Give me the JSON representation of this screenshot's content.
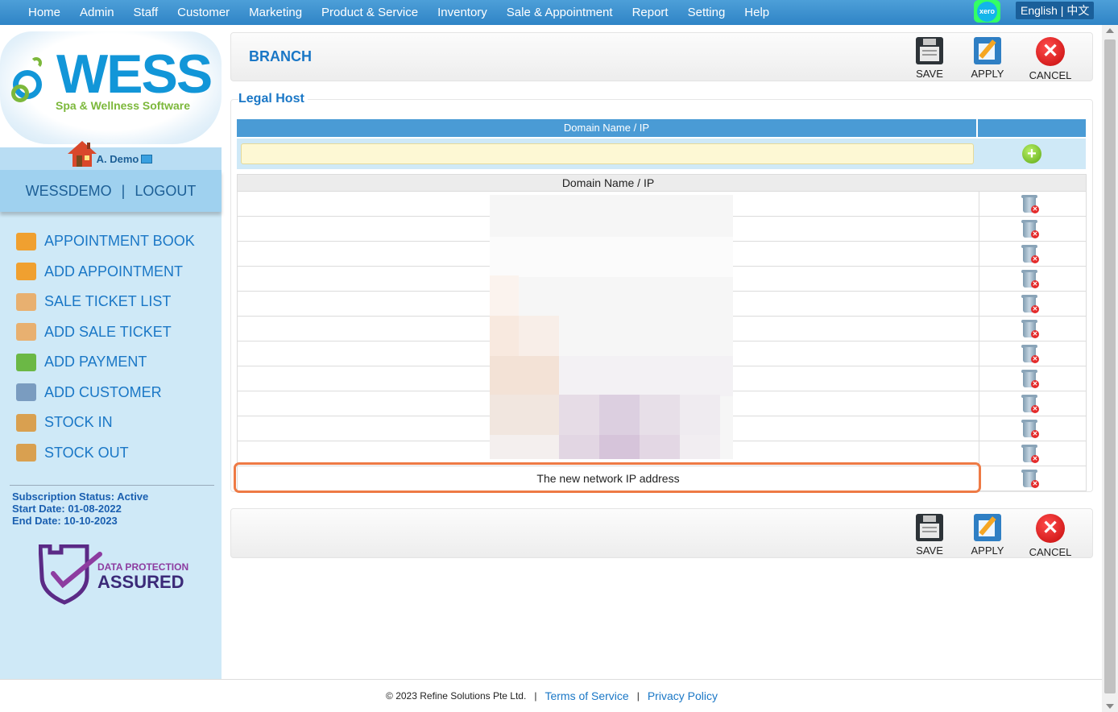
{
  "nav": {
    "items": [
      "Home",
      "Admin",
      "Staff",
      "Customer",
      "Marketing",
      "Product & Service",
      "Inventory",
      "Sale & Appointment",
      "Report",
      "Setting",
      "Help"
    ],
    "xero_label": "xero",
    "language": "English | 中文"
  },
  "sidebar": {
    "logo_title": "WESS",
    "logo_subtitle": "Spa & Wellness Software",
    "user_name": "A. Demo",
    "account": "WESSDEMO",
    "separator": "|",
    "logout": "LOGOUT",
    "quick_links": [
      {
        "label": "APPOINTMENT BOOK",
        "icon": "calendar-icon"
      },
      {
        "label": "ADD APPOINTMENT",
        "icon": "calendar-add-icon"
      },
      {
        "label": "SALE TICKET LIST",
        "icon": "receipt-list-icon"
      },
      {
        "label": "ADD SALE TICKET",
        "icon": "receipt-add-icon"
      },
      {
        "label": "ADD PAYMENT",
        "icon": "money-icon"
      },
      {
        "label": "ADD CUSTOMER",
        "icon": "customer-card-icon"
      },
      {
        "label": "STOCK IN",
        "icon": "box-in-icon"
      },
      {
        "label": "STOCK OUT",
        "icon": "box-out-icon"
      }
    ],
    "subscription_status": "Subscription Status: Active",
    "start_date": "Start Date: 01-08-2022",
    "end_date": "End Date: 10-10-2023",
    "badge_line1": "DATA PROTECTION",
    "badge_line2": "ASSURED"
  },
  "page": {
    "title": "BRANCH",
    "save_label": "SAVE",
    "apply_label": "APPLY",
    "cancel_label": "CANCEL",
    "section_legend": "Legal Host",
    "add_header": "Domain Name / IP",
    "list_header": "Domain Name / IP",
    "rows": [
      "",
      "",
      "",
      "",
      "",
      "",
      "",
      "",
      "",
      "",
      "",
      "The new network IP address"
    ]
  },
  "footer": {
    "copyright": "© 2023 Refine Solutions Pte Ltd.",
    "separator": "|",
    "terms": "Terms of Service",
    "privacy": "Privacy Policy"
  },
  "colors": {
    "accent": "#1a77c6",
    "nav_bar": "#3a8fcf",
    "highlight_border": "#ee7a45"
  }
}
